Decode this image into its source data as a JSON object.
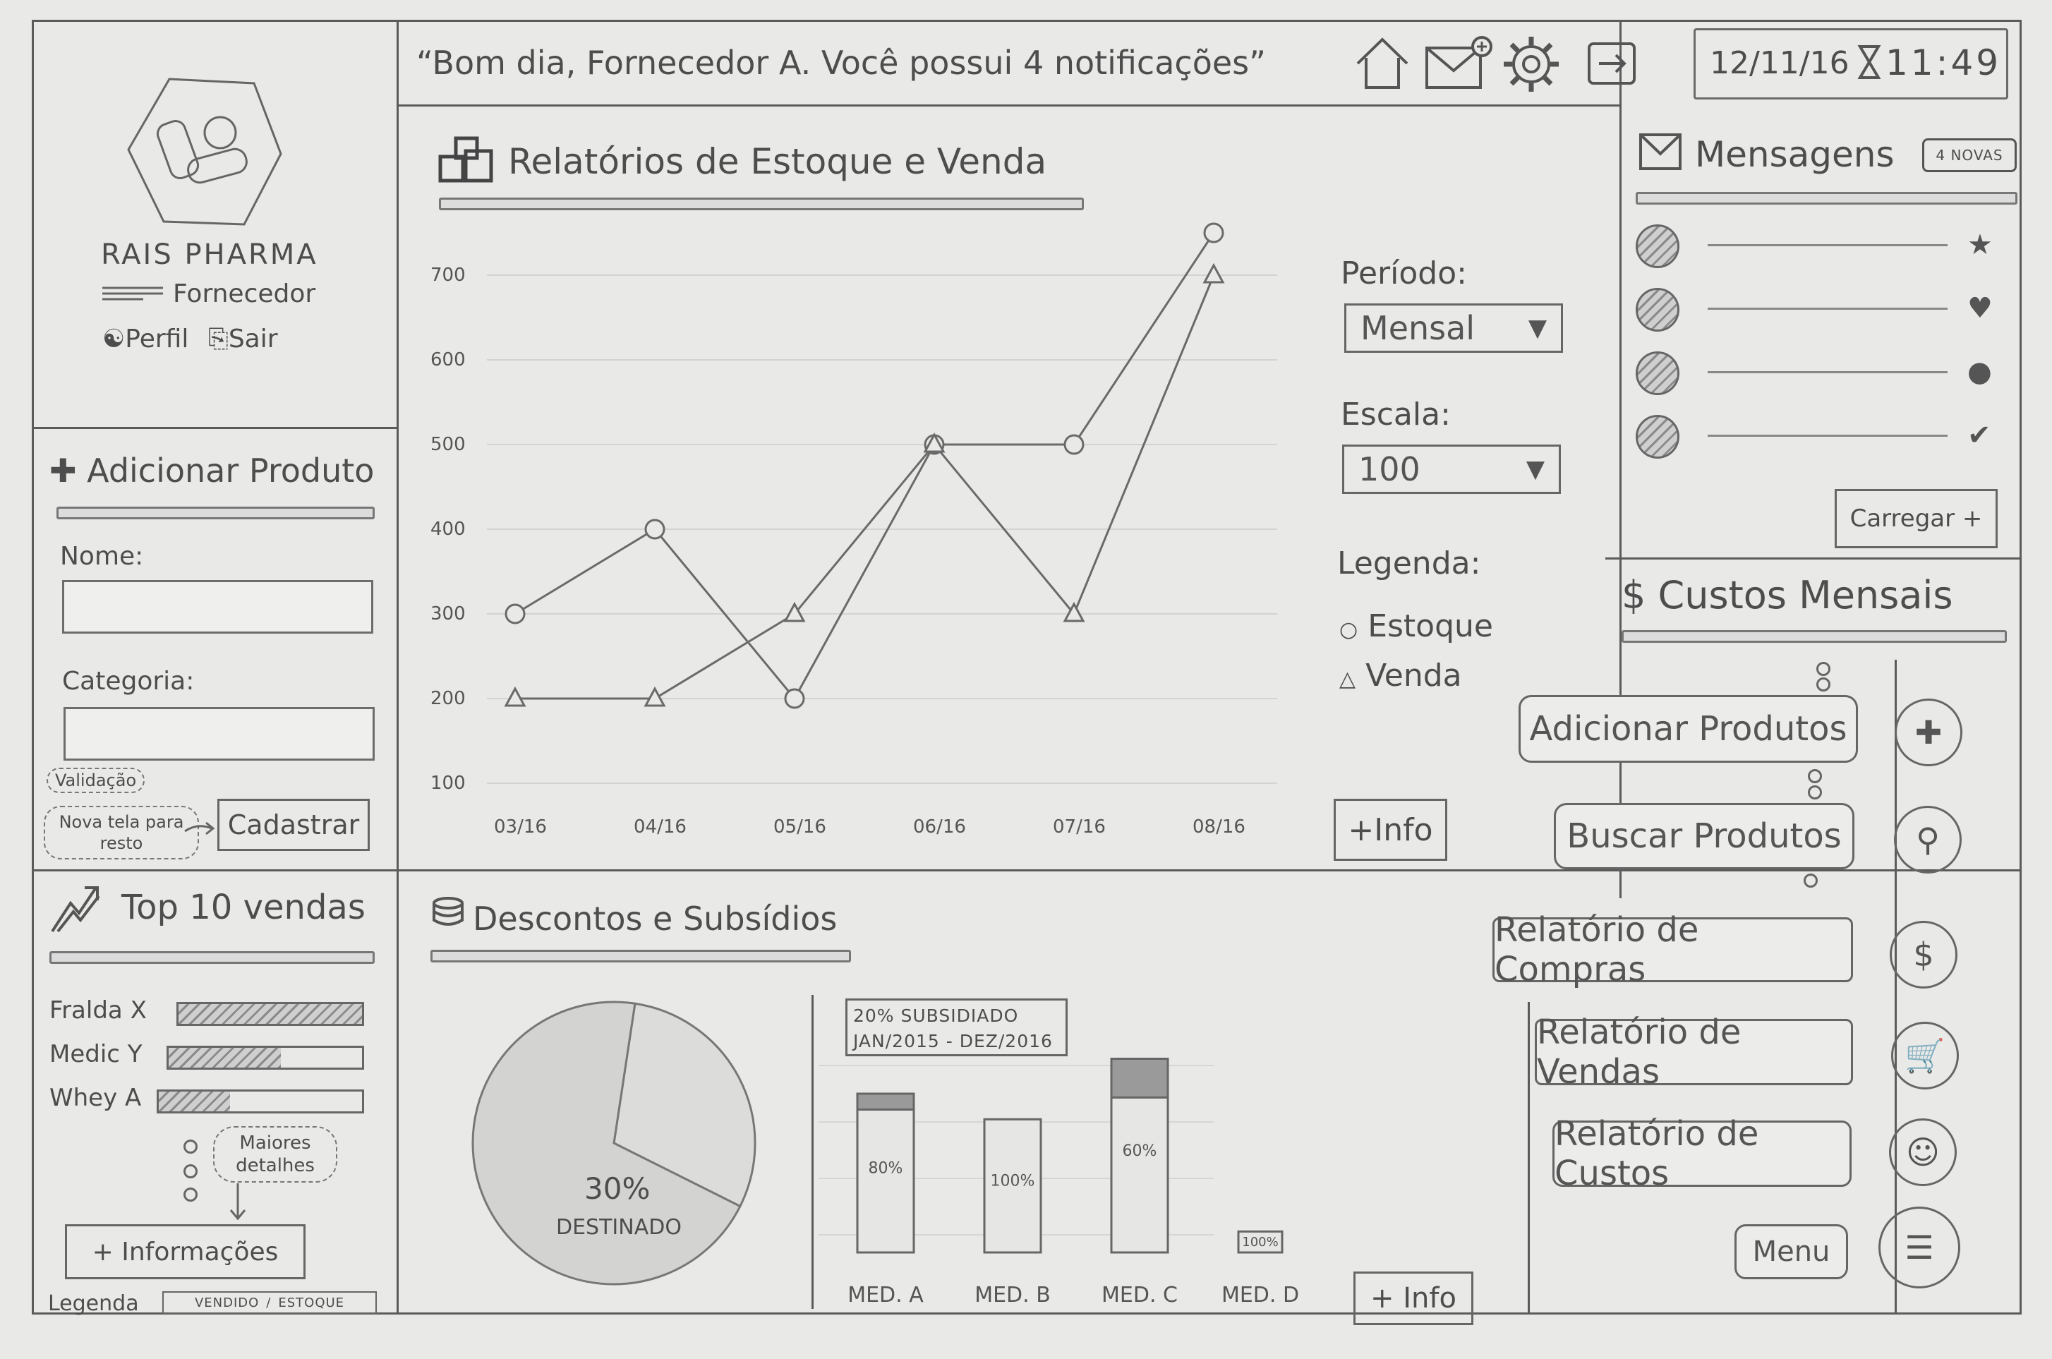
{
  "header": {
    "greeting": "“Bom dia, Fornecedor A. Você possui 4 notificações”",
    "date": "12/11/16",
    "time": "11:49"
  },
  "profile": {
    "company": "RAIS PHARMA",
    "role": "Fornecedor",
    "profile_link": "Perfil",
    "logout_link": "Sair"
  },
  "add_product": {
    "title": "Adicionar Produto",
    "name_label": "Nome:",
    "category_label": "Categoria:",
    "note_validation": "Validação",
    "note_new_screen": "Nova tela para resto",
    "submit_label": "Cadastrar"
  },
  "top_sales": {
    "title": "Top 10 vendas",
    "items": [
      {
        "label": "Fralda X",
        "value": 1.0
      },
      {
        "label": "Medic Y",
        "value": 0.58
      },
      {
        "label": "Whey A",
        "value": 0.35
      }
    ],
    "note": "Maiores detalhes",
    "more_button": "+ Informações",
    "legend_label": "Legenda",
    "legend_sales": "VENDIDO",
    "legend_stock": "ESTOQUE"
  },
  "reports": {
    "title": "Relatórios de Estoque e Venda",
    "period_label": "Período:",
    "period_value": "Mensal",
    "scale_label": "Escala:",
    "scale_value": "100",
    "legend_label": "Legenda:",
    "legend_stock": "Estoque",
    "legend_sales": "Venda",
    "more_button": "+Info"
  },
  "discounts": {
    "title": "Descontos e Subsídios",
    "pie_value": "30%",
    "pie_label": "DESTINADO",
    "callout_line1": "20% SUBSIDIADO",
    "callout_line2": "JAN/2015 - DEZ/2016",
    "more_button": "+ Info"
  },
  "messages": {
    "title": "Mensagens",
    "badge": "4 NOVAS",
    "load_button": "Carregar +"
  },
  "costs": {
    "title": "Custos Mensais"
  },
  "actions": {
    "add_products": "Adicionar Produtos",
    "search_products": "Buscar Produtos",
    "purchases_report": "Relatório de Compras",
    "sales_report": "Relatório de Vendas",
    "costs_report": "Relatório de Custos",
    "menu": "Menu"
  },
  "chart_data": [
    {
      "type": "line",
      "categories": [
        "03/16",
        "04/16",
        "05/16",
        "06/16",
        "07/16",
        "08/16"
      ],
      "y_ticks": [
        "100",
        "200",
        "300",
        "400",
        "500",
        "600",
        "700"
      ],
      "ylim": [
        100,
        750
      ],
      "series": [
        {
          "name": "Estoque",
          "marker": "circle",
          "values": [
            300,
            400,
            200,
            500,
            500,
            750
          ]
        },
        {
          "name": "Venda",
          "marker": "triangle",
          "values": [
            200,
            200,
            300,
            500,
            300,
            700
          ]
        }
      ]
    },
    {
      "type": "pie",
      "slices": [
        {
          "label": "30% DESTINADO",
          "value": 30
        },
        {
          "label": "",
          "value": 70
        }
      ]
    },
    {
      "type": "bar",
      "categories": [
        "MED. A",
        "MED. B",
        "MED. C",
        "MED. D"
      ],
      "bar_labels": [
        "80%",
        "100%",
        "60%",
        "100%"
      ],
      "values": [
        80,
        100,
        60,
        100
      ],
      "bar_heights": [
        1.0,
        0.78,
        1.3,
        0.18
      ]
    }
  ]
}
